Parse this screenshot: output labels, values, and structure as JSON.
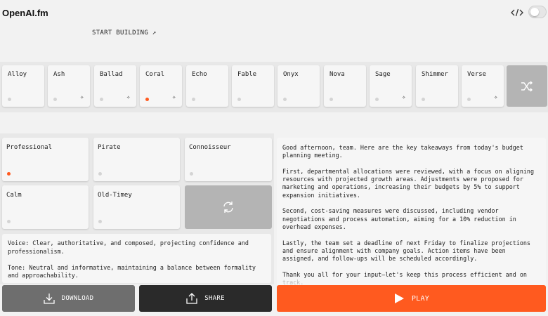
{
  "header": {
    "brand": "OpenAI.fm",
    "start_link": "START BUILDING ↗"
  },
  "voices": [
    {
      "label": "Alloy",
      "selected": false,
      "sparkle": false
    },
    {
      "label": "Ash",
      "selected": false,
      "sparkle": true
    },
    {
      "label": "Ballad",
      "selected": false,
      "sparkle": true
    },
    {
      "label": "Coral",
      "selected": true,
      "sparkle": true
    },
    {
      "label": "Echo",
      "selected": false,
      "sparkle": false
    },
    {
      "label": "Fable",
      "selected": false,
      "sparkle": false
    },
    {
      "label": "Onyx",
      "selected": false,
      "sparkle": false
    },
    {
      "label": "Nova",
      "selected": false,
      "sparkle": false
    },
    {
      "label": "Sage",
      "selected": false,
      "sparkle": true
    },
    {
      "label": "Shimmer",
      "selected": false,
      "sparkle": false
    },
    {
      "label": "Verse",
      "selected": false,
      "sparkle": true
    }
  ],
  "vibes": [
    {
      "label": "Professional",
      "selected": true
    },
    {
      "label": "Pirate",
      "selected": false
    },
    {
      "label": "Connoisseur",
      "selected": false
    },
    {
      "label": "Calm",
      "selected": false
    },
    {
      "label": "Old-Timey",
      "selected": false
    }
  ],
  "description": {
    "voice": "Voice: Clear, authoritative, and composed, projecting confidence and professionalism.",
    "tone": "Tone: Neutral and informative, maintaining a balance between formality and approachability."
  },
  "script": {
    "p1": "Good afternoon, team. Here are the key takeaways from today's budget planning meeting.",
    "p2": "First, departmental allocations were reviewed, with a focus on aligning resources with projected growth areas. Adjustments were proposed for marketing and operations, increasing their budgets by 5% to support expansion initiatives.",
    "p3": "Second, cost-saving measures were discussed, including vendor negotiations and process automation, aiming for a 10% reduction in overhead expenses.",
    "p4": "Lastly, the team set a deadline of next Friday to finalize projections and ensure alignment with company goals. Action items have been assigned, and follow-ups will be scheduled accordingly.",
    "p5": "Thank you all for your input—let's keep this process efficient and on",
    "p5_tail": "track."
  },
  "actions": {
    "download": "DOWNLOAD",
    "share": "SHARE",
    "play": "PLAY"
  },
  "colors": {
    "accent": "#ff5a1f",
    "background": "#f2f2f2",
    "panel": "#e8e8e8",
    "card": "#f6f6f6"
  }
}
